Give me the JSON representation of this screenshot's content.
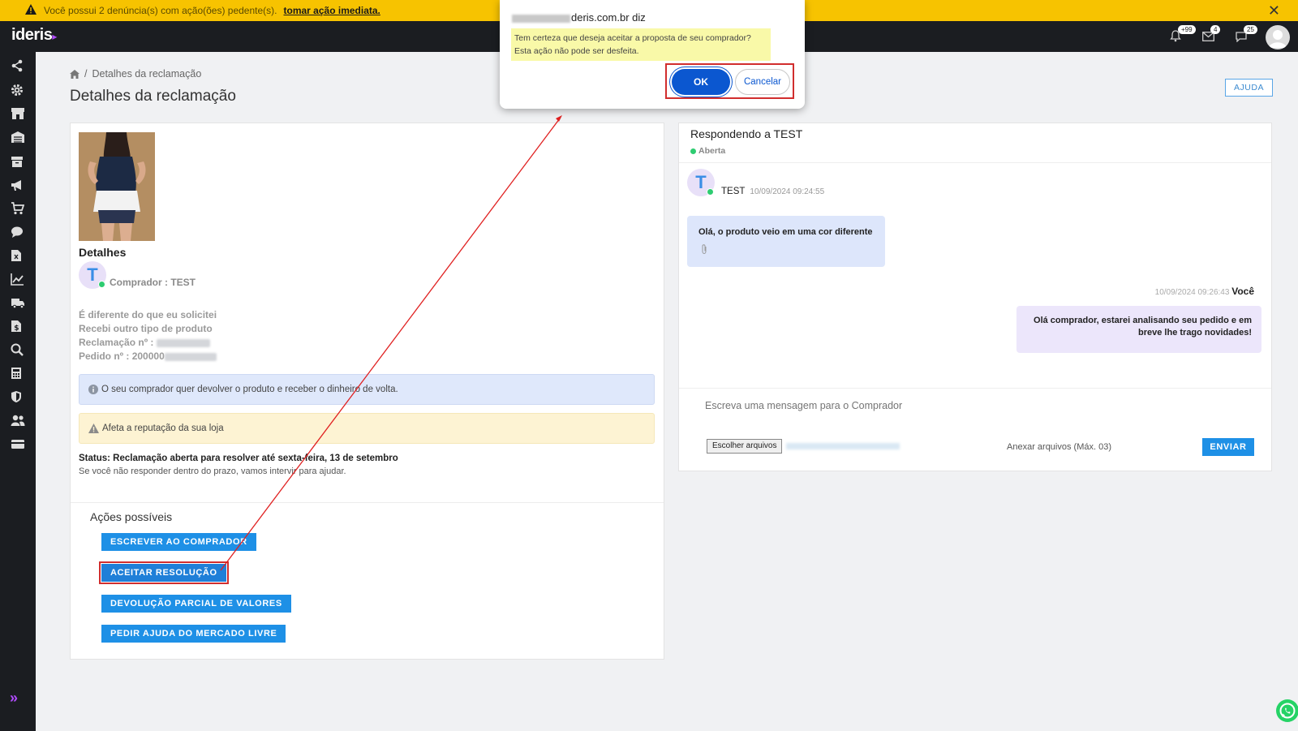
{
  "alert": {
    "text": "Você possui 2 denúncia(s) com ação(ões) pedente(s).",
    "link": "tomar ação imediata.",
    "close": "✕"
  },
  "topbar": {
    "logo": "ideris",
    "logo_mark": "▸",
    "badges": {
      "notifications": "+99",
      "mail": "4",
      "messages": "25"
    }
  },
  "breadcrumb": {
    "separator": "/",
    "current": "Detalhes da reclamação"
  },
  "page": {
    "title": "Detalhes da reclamação",
    "help_button": "AJUDA"
  },
  "details": {
    "heading": "Detalhes",
    "avatar_letter": "T",
    "buyer_label": "Comprador : TEST",
    "reason": "É diferente do que eu solicitei",
    "sub_reason": "Recebi outro tipo de produto",
    "claim_label": "Reclamação nº :",
    "order_label": "Pedido nº : 200000",
    "info_message": "O seu comprador quer devolver o produto e receber o dinheiro de volta.",
    "warning_message": "Afeta a reputação da sua loja",
    "status": "Status: Reclamação aberta para resolver até sexta-feira, 13 de setembro",
    "status_note": "Se você não responder dentro do prazo, vamos intervir para ajudar."
  },
  "actions": {
    "title": "Ações possíveis",
    "buttons": [
      "ESCREVER AO COMPRADOR",
      "ACEITAR RESOLUÇÃO",
      "DEVOLUÇÃO PARCIAL DE VALORES",
      "PEDIR AJUDA DO MERCADO LIVRE"
    ]
  },
  "chat": {
    "title": "Respondendo a TEST",
    "status": "Aberta",
    "incoming": {
      "avatar_letter": "T",
      "author": "TEST",
      "time": "10/09/2024 09:24:55",
      "text": "Olá, o produto veio em uma cor diferente"
    },
    "outgoing": {
      "time": "10/09/2024 09:26:43",
      "author": "Você",
      "text": "Olá comprador, estarei analisando seu pedido e em breve lhe trago novidades!"
    },
    "compose_placeholder": "Escreva uma mensagem para o Comprador",
    "file_button": "Escolher arquivos",
    "attach_label": "Anexar arquivos (Máx. 03)",
    "send_button": "ENVIAR"
  },
  "dialog": {
    "origin": "deris.com.br diz",
    "line1": "Tem certeza que deseja aceitar a proposta de seu comprador?",
    "line2": "Esta ação não pode ser desfeita.",
    "ok": "OK",
    "cancel": "Cancelar"
  },
  "colors": {
    "alert_bg": "#f7c300",
    "nav_bg": "#1b1d21",
    "primary": "#1e90e6",
    "dialog_ok": "#0b57d0",
    "highlight": "#d12e2e",
    "brand_accent": "#b14cff"
  }
}
